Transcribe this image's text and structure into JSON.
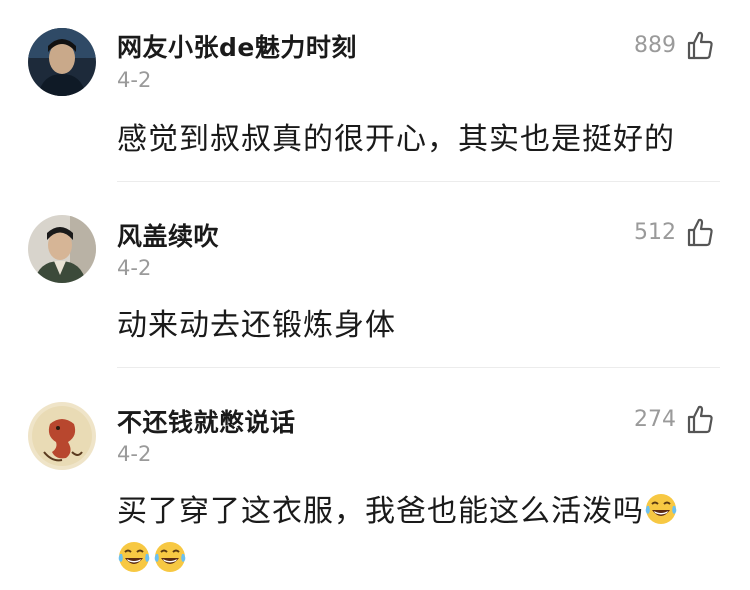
{
  "comments": [
    {
      "user": "网友小张de魅力时刻",
      "date": "4-2",
      "likes": "889",
      "text": "感觉到叔叔真的很开心，其实也是挺好的",
      "emoji_count": 0
    },
    {
      "user": "风盖续吹",
      "date": "4-2",
      "likes": "512",
      "text": "动来动去还锻炼身体",
      "emoji_count": 0
    },
    {
      "user": "不还钱就憋说话",
      "date": "4-2",
      "likes": "274",
      "text": "买了穿了这衣服，我爸也能这么活泼吗",
      "emoji": "laughing-tears-emoji",
      "emoji_count": 3
    }
  ],
  "icons": {
    "like": "thumbs-up-outline-icon"
  },
  "colors": {
    "meta": "#9a9a9a",
    "text": "#1a1a1a",
    "divider": "#ececec"
  }
}
